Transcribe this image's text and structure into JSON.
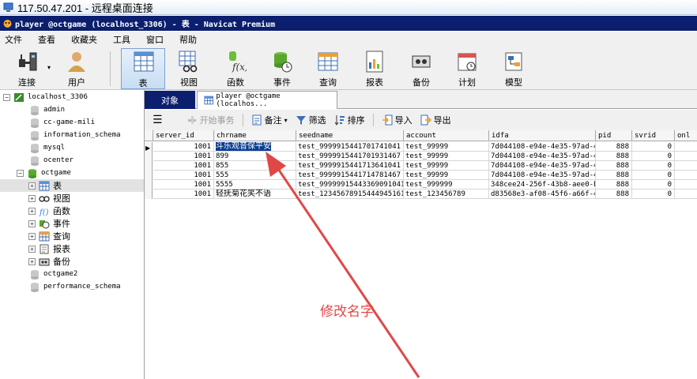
{
  "remote_window": {
    "title": "117.50.47.201 - 远程桌面连接"
  },
  "app": {
    "title": "player @octgame (localhost_3306) - 表 - Navicat Premium"
  },
  "menu": [
    "文件",
    "查看",
    "收藏夹",
    "工具",
    "窗口",
    "帮助"
  ],
  "toolbar": {
    "connect": "连接",
    "user": "用户",
    "table": "表",
    "view": "视图",
    "function": "函数",
    "event": "事件",
    "query": "查询",
    "report": "报表",
    "backup": "备份",
    "schedule": "计划",
    "model": "模型"
  },
  "sidebar": {
    "connection": "localhost_3306",
    "databases": [
      "admin",
      "cc-game-mili",
      "information_schema",
      "mysql",
      "ocenter"
    ],
    "open_db": "octgame",
    "open_db_children": [
      "表",
      "视图",
      "函数",
      "事件",
      "查询",
      "报表",
      "备份"
    ],
    "after_dbs": [
      "octgame2",
      "performance_schema"
    ]
  },
  "tabs": {
    "objects": "对象",
    "table_tab": "player @octgame (localhos..."
  },
  "data_toolbar": {
    "begin_transaction": "开始事务",
    "memo": "备注",
    "filter": "筛选",
    "sort": "排序",
    "import": "导入",
    "export": "导出"
  },
  "grid": {
    "columns": [
      "server_id",
      "chrname",
      "seedname",
      "account",
      "idfa",
      "pid",
      "svrid",
      "onl"
    ],
    "rows": [
      [
        "1001",
        "斗乐观音保平安",
        "test_9999915441701741041",
        "test_99999",
        "7d044108-e94e-4e35-97ad-4",
        "888",
        "0",
        ""
      ],
      [
        "1001",
        "899",
        "test_9999915441701931467",
        "test_99999",
        "7d044108-e94e-4e35-97ad-4",
        "888",
        "0",
        ""
      ],
      [
        "1001",
        "855",
        "test_9999915441713641041",
        "test_99999",
        "7d044108-e94e-4e35-97ad-4",
        "888",
        "0",
        ""
      ],
      [
        "1001",
        "555",
        "test_9999915441714781467",
        "test_99999",
        "7d044108-e94e-4e35-97ad-4",
        "888",
        "0",
        ""
      ],
      [
        "1001",
        "5555",
        "test_99999915443369091041",
        "test_999999",
        "348cee24-256f-43b8-aee0-b",
        "888",
        "0",
        ""
      ],
      [
        "1001",
        "轻抚菊花笑不语",
        "test_12345678915444945161",
        "test_123456789",
        "d83568e3-af08-45f6-a66f-4",
        "888",
        "0",
        ""
      ]
    ]
  },
  "annotation": {
    "text": "修改名字",
    "color": "#e04848"
  },
  "colors": {
    "title_bar": "#0b1f6e",
    "selection": "#0b3d91",
    "arrow": "#e04848"
  }
}
